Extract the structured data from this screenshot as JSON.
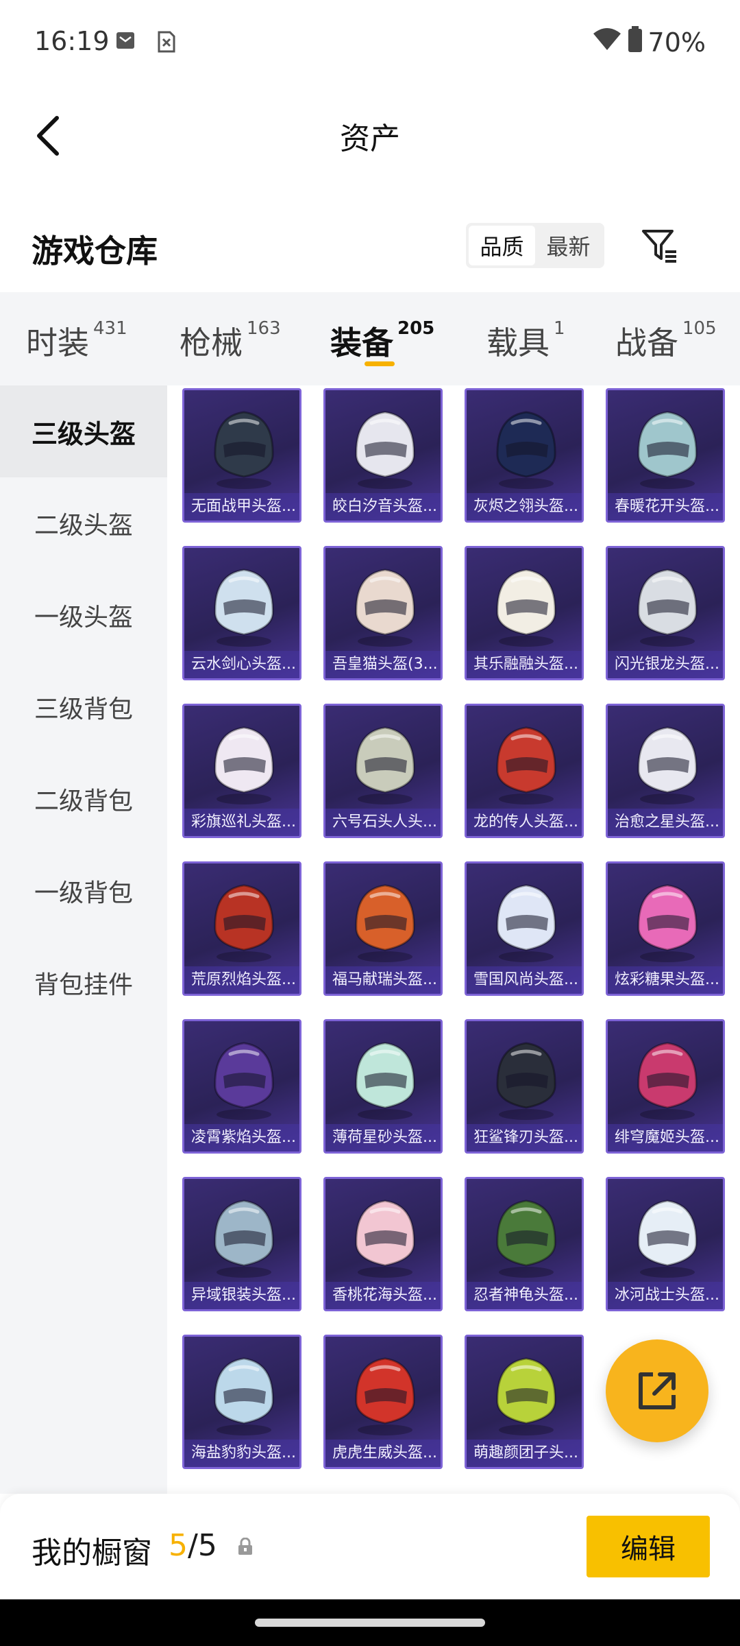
{
  "status": {
    "time": "16:19",
    "battery": "70%"
  },
  "header": {
    "title": "资产"
  },
  "warehouse": {
    "title": "游戏仓库",
    "sort_options": [
      "品质",
      "最新"
    ],
    "active_sort": "品质"
  },
  "tabs": [
    {
      "label": "时装",
      "count": "431"
    },
    {
      "label": "枪械",
      "count": "163"
    },
    {
      "label": "装备",
      "count": "205"
    },
    {
      "label": "载具",
      "count": "1"
    },
    {
      "label": "战备",
      "count": "105"
    }
  ],
  "sidebar": {
    "items": [
      "三级头盔",
      "二级头盔",
      "一级头盔",
      "三级背包",
      "二级背包",
      "一级背包",
      "背包挂件"
    ]
  },
  "items": [
    {
      "label": "无面战甲头盔...",
      "color": "#2f3a4a"
    },
    {
      "label": "皎白汐音头盔...",
      "color": "#e6e6ee"
    },
    {
      "label": "灰烬之翎头盔...",
      "color": "#1e2a55"
    },
    {
      "label": "春暖花开头盔...",
      "color": "#9fc6cc"
    },
    {
      "label": "云水剑心头盔...",
      "color": "#cfe0ee"
    },
    {
      "label": "吾皇猫头盔(3...",
      "color": "#e9d9cf"
    },
    {
      "label": "其乐融融头盔...",
      "color": "#f2eee4"
    },
    {
      "label": "闪光银龙头盔...",
      "color": "#d9dde3"
    },
    {
      "label": "彩旗巡礼头盔...",
      "color": "#efe8f2"
    },
    {
      "label": "六号石头人头...",
      "color": "#c9ccbb"
    },
    {
      "label": "龙的传人头盔...",
      "color": "#c83a2e"
    },
    {
      "label": "治愈之星头盔...",
      "color": "#e8e8f0"
    },
    {
      "label": "荒原烈焰头盔...",
      "color": "#b83324"
    },
    {
      "label": "福马献瑞头盔...",
      "color": "#d8602a"
    },
    {
      "label": "雪国风尚头盔...",
      "color": "#dfe6f6"
    },
    {
      "label": "炫彩糖果头盔...",
      "color": "#e86ab8"
    },
    {
      "label": "凌霄紫焰头盔...",
      "color": "#5a3a9a"
    },
    {
      "label": "薄荷星砂头盔...",
      "color": "#bfe6da"
    },
    {
      "label": "狂鲨锋刃头盔...",
      "color": "#2a2e3a"
    },
    {
      "label": "绯穹魔姬头盔...",
      "color": "#c93a6e"
    },
    {
      "label": "异域银装头盔...",
      "color": "#9db6c8"
    },
    {
      "label": "香桃花海头盔...",
      "color": "#f2c6d2"
    },
    {
      "label": "忍者神龟头盔...",
      "color": "#4a7a3a"
    },
    {
      "label": "冰河战士头盔...",
      "color": "#e6eef6"
    },
    {
      "label": "海盐豹豹头盔...",
      "color": "#bcd8ea"
    },
    {
      "label": "虎虎生威头盔...",
      "color": "#d2342a"
    },
    {
      "label": "萌趣颜团子头...",
      "color": "#b8d23a"
    }
  ],
  "showcase": {
    "label": "我的橱窗",
    "current": "5",
    "total": "/5",
    "edit_label": "编辑"
  },
  "colors": {
    "accent": "#f7b100",
    "card_bg": "#2b2257",
    "card_border": "#7d63d6"
  }
}
